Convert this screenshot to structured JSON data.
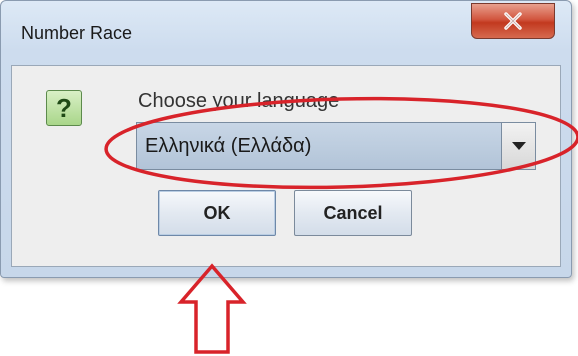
{
  "window": {
    "title": "Number Race"
  },
  "dialog": {
    "prompt": "Choose your language",
    "language_select": {
      "selected": "Ελληνικά (Ελλάδα)"
    },
    "ok_label": "OK",
    "cancel_label": "Cancel"
  },
  "icons": {
    "close": "close-icon",
    "question": "question-icon",
    "dropdown": "chevron-down-icon",
    "arrow": "up-arrow-annotation"
  },
  "colors": {
    "annotation": "#d8232a",
    "close_button": "#c2391f",
    "question_icon": "#a9d68a"
  }
}
